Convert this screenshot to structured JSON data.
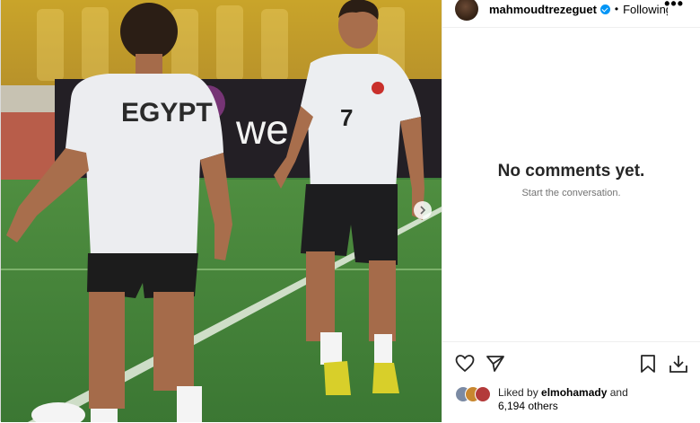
{
  "post_header": {
    "username": "mahmoudtrezeguet",
    "separator": "•",
    "follow_state": "Following",
    "more_label": "•••"
  },
  "media": {
    "description_icon": "photo",
    "jersey_text_left": "EGYPT",
    "jersey_number_right": "7",
    "banner_text": "we"
  },
  "comments": {
    "empty_title": "No comments yet.",
    "empty_subtitle": "Start the conversation."
  },
  "likes": {
    "prefix": "Liked by",
    "user": "elmohamady",
    "joiner": "and",
    "others": "6,194 others"
  },
  "colors": {
    "verified": "#0095f6",
    "pitch": "#3f7f3a",
    "text": "#262626",
    "muted": "#737373"
  },
  "icons": [
    "heart-icon",
    "share-icon",
    "bookmark-icon",
    "download-icon",
    "more-icon",
    "verified-icon",
    "chevron-right-icon"
  ]
}
